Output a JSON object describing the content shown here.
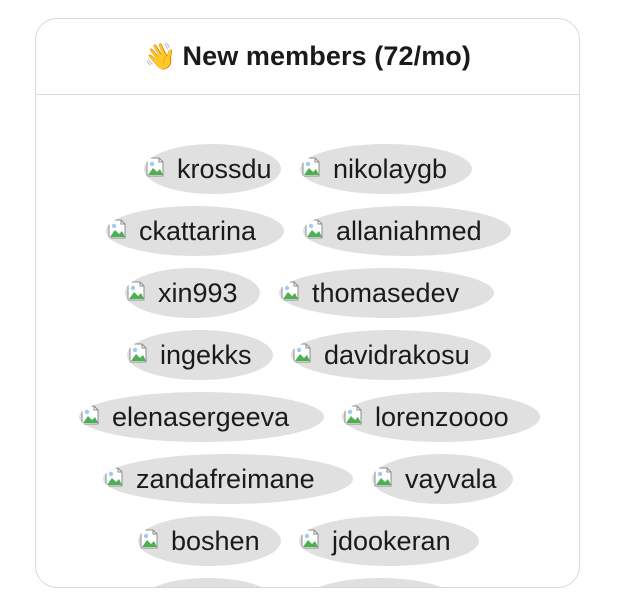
{
  "header": {
    "emoji": "👋",
    "title": "New members (72/mo)"
  },
  "members": [
    {
      "name": "krossdu"
    },
    {
      "name": "nikolaygb"
    },
    {
      "name": "ckattarina"
    },
    {
      "name": "allaniahmed"
    },
    {
      "name": "xin993"
    },
    {
      "name": "thomasedev"
    },
    {
      "name": "ingekks"
    },
    {
      "name": "davidrakosu"
    },
    {
      "name": "elenasergeeva"
    },
    {
      "name": "lorenzoooo"
    },
    {
      "name": "zandafreimane"
    },
    {
      "name": "vayvala"
    },
    {
      "name": "boshen"
    },
    {
      "name": "jdookeran"
    },
    {
      "name": ""
    },
    {
      "name": ""
    }
  ]
}
